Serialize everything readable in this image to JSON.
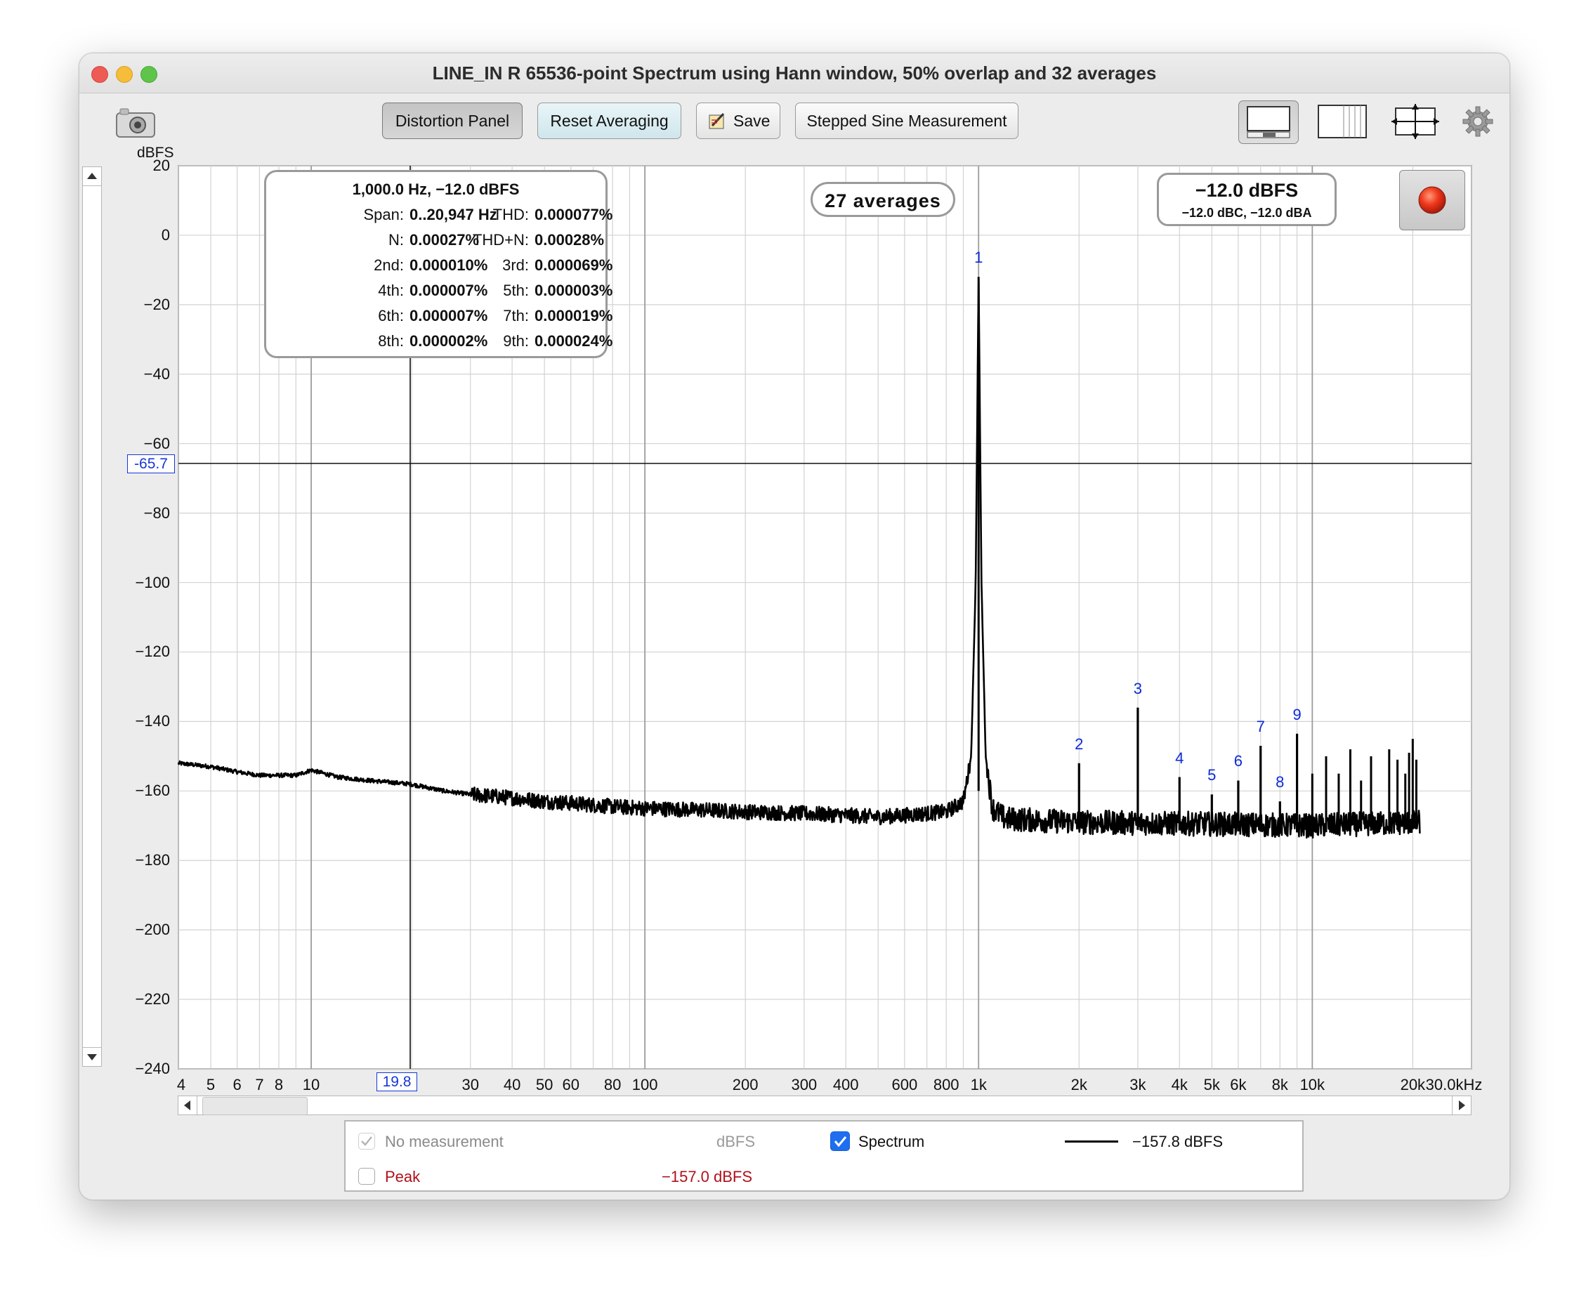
{
  "window": {
    "title": "LINE_IN R 65536-point Spectrum using Hann window, 50% overlap and 32 averages"
  },
  "toolbar": {
    "distortion_panel": "Distortion Panel",
    "reset_averaging": "Reset Averaging",
    "save": "Save",
    "stepped_sine": "Stepped Sine Measurement"
  },
  "chart_data": {
    "type": "line",
    "ylabel": "dBFS",
    "xlabel": "",
    "x_scale": "log",
    "xlim": [
      4,
      30000
    ],
    "ylim": [
      -240,
      20
    ],
    "y_ticks": [
      "20",
      "0",
      "-20",
      "-40",
      "-60",
      "-80",
      "-100",
      "-120",
      "-140",
      "-160",
      "-180",
      "-200",
      "-220",
      "-240"
    ],
    "x_ticks": [
      "4",
      "5",
      "6",
      "7",
      "8",
      "10",
      "30",
      "40",
      "50",
      "60",
      "80",
      "100",
      "200",
      "300",
      "400",
      "600",
      "800",
      "1k",
      "2k",
      "3k",
      "4k",
      "5k",
      "6k",
      "8k",
      "10k",
      "20k",
      "30.0kHz"
    ],
    "cursor": {
      "x": 19.8,
      "y": -65.7,
      "x_label": "19.8",
      "y_label": "-65.7"
    },
    "series": [
      {
        "name": "Spectrum",
        "color": "#000000",
        "noise_floor": [
          [
            4,
            -152
          ],
          [
            5,
            -153
          ],
          [
            6,
            -154.5
          ],
          [
            7,
            -155.5
          ],
          [
            8,
            -155.5
          ],
          [
            9,
            -155.5
          ],
          [
            10,
            -154
          ],
          [
            12,
            -156
          ],
          [
            15,
            -157
          ],
          [
            19.8,
            -158
          ],
          [
            25,
            -160
          ],
          [
            30,
            -161
          ],
          [
            40,
            -162
          ],
          [
            50,
            -163
          ],
          [
            60,
            -163.5
          ],
          [
            80,
            -164.5
          ],
          [
            100,
            -165
          ],
          [
            150,
            -165.5
          ],
          [
            200,
            -166
          ],
          [
            300,
            -166.5
          ],
          [
            400,
            -167
          ],
          [
            500,
            -167.5
          ],
          [
            600,
            -167
          ],
          [
            800,
            -166
          ],
          [
            900,
            -163
          ],
          [
            950,
            -150
          ],
          [
            980,
            -100
          ],
          [
            1000,
            -12
          ],
          [
            1020,
            -100
          ],
          [
            1050,
            -150
          ],
          [
            1100,
            -165
          ],
          [
            1200,
            -168
          ],
          [
            2000,
            -169
          ],
          [
            5000,
            -169.5
          ],
          [
            10000,
            -170
          ],
          [
            21000,
            -169
          ]
        ],
        "harmonic_peaks": [
          [
            2000,
            -152
          ],
          [
            3000,
            -136
          ],
          [
            4000,
            -156
          ],
          [
            5000,
            -161
          ],
          [
            6000,
            -157
          ],
          [
            7000,
            -147
          ],
          [
            8000,
            -163
          ],
          [
            9000,
            -143.5
          ]
        ],
        "spurs": [
          [
            10000,
            -155
          ],
          [
            11000,
            -150
          ],
          [
            12000,
            -155
          ],
          [
            13000,
            -148
          ],
          [
            14000,
            -157
          ],
          [
            15000,
            -150
          ],
          [
            17000,
            -148
          ],
          [
            18000,
            -151
          ],
          [
            19000,
            -155
          ],
          [
            19500,
            -149
          ],
          [
            20000,
            -145
          ],
          [
            20500,
            -151
          ]
        ]
      }
    ],
    "harmonic_labels": [
      {
        "label": "1",
        "x": 1000,
        "y": -12
      },
      {
        "label": "2",
        "x": 2000,
        "y": -152
      },
      {
        "label": "3",
        "x": 3000,
        "y": -136
      },
      {
        "label": "4",
        "x": 4000,
        "y": -156
      },
      {
        "label": "5",
        "x": 5000,
        "y": -161
      },
      {
        "label": "6",
        "x": 6000,
        "y": -157
      },
      {
        "label": "7",
        "x": 7000,
        "y": -147
      },
      {
        "label": "8",
        "x": 8000,
        "y": -163
      },
      {
        "label": "9",
        "x": 9000,
        "y": -143.5
      }
    ]
  },
  "info": {
    "header": "1,000.0 Hz, −12.0 dBFS",
    "rows": [
      [
        {
          "k": "Span:",
          "v": "0..20,947 Hz"
        },
        {
          "k": "THD:",
          "v": "0.000077%"
        }
      ],
      [
        {
          "k": "N:",
          "v": "0.00027%"
        },
        {
          "k": "THD+N:",
          "v": "0.00028%"
        }
      ],
      [
        {
          "k": "2nd:",
          "v": "0.000010%"
        },
        {
          "k": "3rd:",
          "v": "0.000069%"
        }
      ],
      [
        {
          "k": "4th:",
          "v": "0.000007%"
        },
        {
          "k": "5th:",
          "v": "0.000003%"
        }
      ],
      [
        {
          "k": "6th:",
          "v": "0.000007%"
        },
        {
          "k": "7th:",
          "v": "0.000019%"
        }
      ],
      [
        {
          "k": "8th:",
          "v": "0.000002%"
        },
        {
          "k": "9th:",
          "v": "0.000024%"
        }
      ]
    ]
  },
  "averages": "27 averages",
  "level": {
    "main": "−12.0 dBFS",
    "sub": "−12.0 dBC, −12.0 dBA"
  },
  "legend": {
    "row1": {
      "label": "No measurement",
      "unit": "dBFS"
    },
    "row2": {
      "label": "Peak",
      "value": "−157.0 dBFS",
      "color": "#b0101a"
    },
    "spectrum": {
      "label": "Spectrum",
      "value": "−157.8 dBFS",
      "checked": true
    }
  },
  "colors": {
    "accent": "#1f6ef0",
    "trace": "#000000",
    "cursor_label": "#0b2ad6",
    "record": "#e22b1a"
  }
}
